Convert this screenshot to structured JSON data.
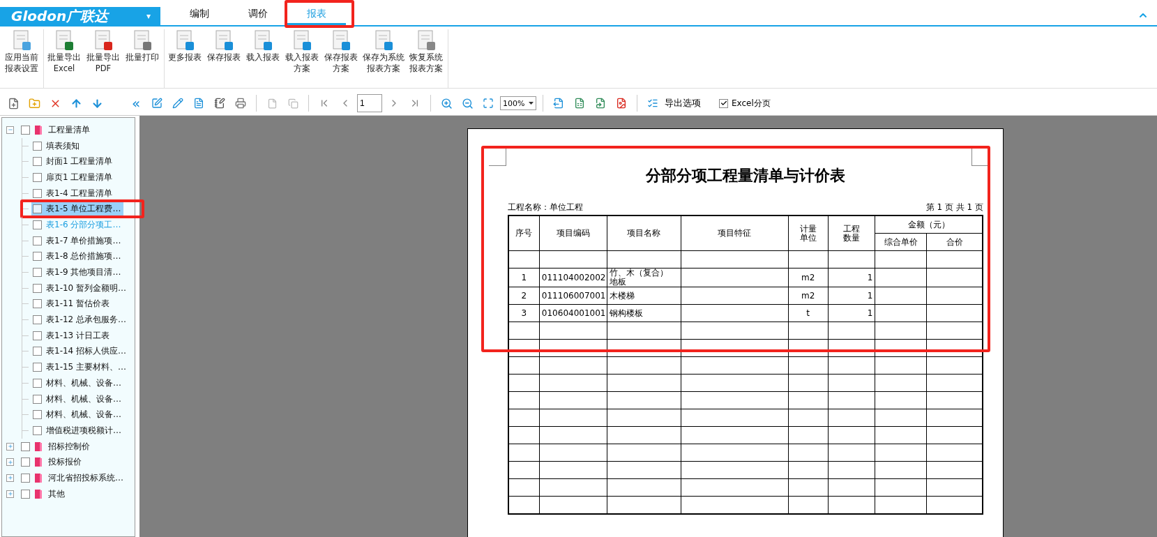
{
  "logo": {
    "text": "Glodon广联达",
    "caret": "▾"
  },
  "tabs": [
    {
      "label": "编制",
      "selected": false,
      "marked": false
    },
    {
      "label": "调价",
      "selected": false,
      "marked": false
    },
    {
      "label": "报表",
      "selected": true,
      "marked": true
    }
  ],
  "ribbon": [
    [
      {
        "lines": [
          "应用当前",
          "报表设置"
        ]
      }
    ],
    [
      {
        "lines": [
          "批量导出",
          "Excel"
        ]
      },
      {
        "lines": [
          "批量导出",
          "PDF"
        ]
      },
      {
        "lines": [
          "批量打印"
        ]
      }
    ],
    [
      {
        "lines": [
          "更多报表"
        ]
      },
      {
        "lines": [
          "保存报表"
        ]
      },
      {
        "lines": [
          "载入报表"
        ]
      },
      {
        "lines": [
          "载入报表",
          "方案"
        ]
      },
      {
        "lines": [
          "保存报表",
          "方案"
        ]
      },
      {
        "lines": [
          "保存为系统",
          "报表方案"
        ]
      },
      {
        "lines": [
          "恢复系统",
          "报表方案"
        ]
      }
    ]
  ],
  "toolbar": {
    "collapse": "«",
    "page": "1",
    "zoom": "100%",
    "export_options": "导出选项",
    "excel_paging": {
      "label": "Excel分页",
      "checked": true
    }
  },
  "tree": [
    {
      "label": "工程量清单",
      "checked": false,
      "expanded": true,
      "children": [
        {
          "label": "填表须知",
          "checked": false,
          "selected": false,
          "hovered": false,
          "marked": false
        },
        {
          "label": "封面1 工程量清单",
          "checked": false,
          "selected": false,
          "hovered": false,
          "marked": false
        },
        {
          "label": "扉页1 工程量清单",
          "checked": false,
          "selected": false,
          "hovered": false,
          "marked": false
        },
        {
          "label": "表1-4 工程量清单",
          "checked": false,
          "selected": false,
          "hovered": false,
          "marked": false
        },
        {
          "label": "表1-5 单位工程费…",
          "checked": false,
          "selected": false,
          "hovered": true,
          "marked": true
        },
        {
          "label": "表1-6 分部分项工…",
          "checked": false,
          "selected": true,
          "hovered": false,
          "marked": false
        },
        {
          "label": "表1-7 单价措施项…",
          "checked": false,
          "selected": false,
          "hovered": false,
          "marked": false
        },
        {
          "label": "表1-8 总价措施项…",
          "checked": false,
          "selected": false,
          "hovered": false,
          "marked": false
        },
        {
          "label": "表1-9 其他项目清…",
          "checked": false,
          "selected": false,
          "hovered": false,
          "marked": false
        },
        {
          "label": "表1-10 暂列金额明…",
          "checked": false,
          "selected": false,
          "hovered": false,
          "marked": false
        },
        {
          "label": "表1-11 暂估价表",
          "checked": false,
          "selected": false,
          "hovered": false,
          "marked": false
        },
        {
          "label": "表1-12 总承包服务…",
          "checked": false,
          "selected": false,
          "hovered": false,
          "marked": false
        },
        {
          "label": "表1-13 计日工表",
          "checked": false,
          "selected": false,
          "hovered": false,
          "marked": false
        },
        {
          "label": "表1-14 招标人供应…",
          "checked": false,
          "selected": false,
          "hovered": false,
          "marked": false
        },
        {
          "label": "表1-15 主要材料、…",
          "checked": false,
          "selected": false,
          "hovered": false,
          "marked": false
        },
        {
          "label": "材料、机械、设备…",
          "checked": false,
          "selected": false,
          "hovered": false,
          "marked": false
        },
        {
          "label": "材料、机械、设备…",
          "checked": false,
          "selected": false,
          "hovered": false,
          "marked": false
        },
        {
          "label": "材料、机械、设备…",
          "checked": false,
          "selected": false,
          "hovered": false,
          "marked": false
        },
        {
          "label": "增值税进项税额计…",
          "checked": false,
          "selected": false,
          "hovered": false,
          "marked": false
        }
      ]
    },
    {
      "label": "招标控制价",
      "checked": false,
      "expanded": false
    },
    {
      "label": "投标报价",
      "checked": false,
      "expanded": false
    },
    {
      "label": "河北省招投标系统…",
      "checked": false,
      "expanded": false
    },
    {
      "label": "其他",
      "checked": false,
      "expanded": false
    }
  ],
  "report": {
    "marked": true,
    "title": "分部分项工程量清单与计价表",
    "project": "工程名称：单位工程",
    "page_info": "第 1 页  共 1 页",
    "headers": [
      "序号",
      "项目编码",
      "项目名称",
      "项目特征",
      "计量单位",
      "工程数量"
    ],
    "amount_header": "金额（元）",
    "amount_columns": [
      "综合单价",
      "合价"
    ],
    "rows": [
      {
        "no": "1",
        "code": "011104002002",
        "name": "竹、木（复合）地板",
        "unit": "m2",
        "qty": "1"
      },
      {
        "no": "2",
        "code": "011106007001",
        "name": "木楼梯",
        "unit": "m2",
        "qty": "1"
      },
      {
        "no": "3",
        "code": "010604001001",
        "name": "钢构楼板",
        "unit": "t",
        "qty": "1"
      }
    ]
  }
}
